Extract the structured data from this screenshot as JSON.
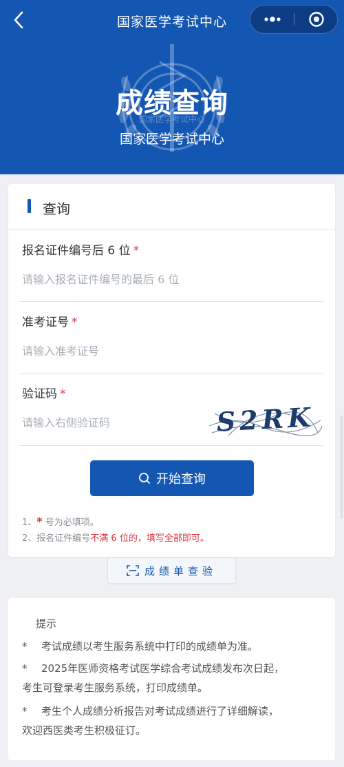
{
  "nav": {
    "title": "国家医学考试中心",
    "back_icon": "chevron-left-icon",
    "more_icon": "more-dots-icon",
    "close_icon": "target-close-icon"
  },
  "hero": {
    "title": "成绩查询",
    "subtitle": "国家医学考试中心",
    "emblem_text": "国家医学考试中心"
  },
  "query": {
    "section_title": "查询",
    "fields": [
      {
        "label": "报名证件编号后 6 位",
        "required_mark": "*",
        "placeholder": "请输入报名证件编号的最后 6 位",
        "value": ""
      },
      {
        "label": "准考证号",
        "required_mark": "*",
        "placeholder": "请输入准考证号",
        "value": ""
      },
      {
        "label": "验证码",
        "required_mark": "*",
        "placeholder": "请输入右侧验证码",
        "value": ""
      }
    ],
    "captcha_text": "S2RK",
    "submit_label": "开始查询",
    "submit_icon": "search-icon",
    "notes": {
      "note1_prefix": "1、",
      "note1_star": "*",
      "note1_text": " 号为必填项。",
      "note2_prefix": "2、报名证件编号",
      "note2_highlight": "不满 6 位的，填写全部即可。"
    }
  },
  "verify": {
    "label": "成绩单查验",
    "icon": "scan-icon"
  },
  "tips": {
    "title": "提示",
    "items": [
      {
        "star": "*",
        "line1": "考试成绩以考生服务系统中打印的成绩单为准。",
        "line2": ""
      },
      {
        "star": "*",
        "line1": "2025年医师资格考试医学综合考试成绩发布次日起，",
        "line2": "考生可登录考生服务系统，打印成绩单。"
      },
      {
        "star": "*",
        "line1": "考生个人成绩分析报告对考试成绩进行了详细解读，",
        "line2": "欢迎西医类考生积极征订。"
      }
    ]
  },
  "colors": {
    "primary": "#1457b3",
    "required": "#d9353b",
    "background": "#eef0f3"
  }
}
